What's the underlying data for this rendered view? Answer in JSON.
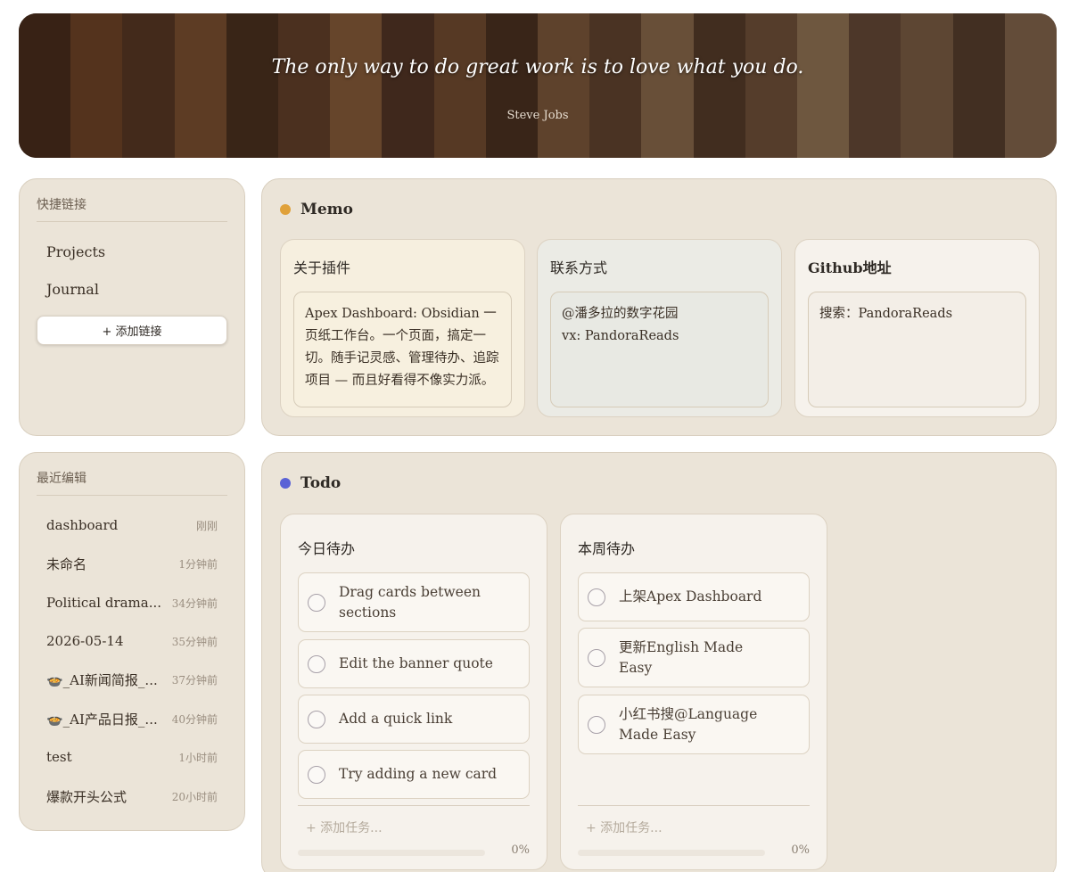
{
  "banner": {
    "quote": "The only way to do great work is to love what you do.",
    "author": "Steve Jobs"
  },
  "quick_links": {
    "title": "快捷链接",
    "items": [
      "Projects",
      "Journal"
    ],
    "add_label": "+ 添加链接"
  },
  "recent": {
    "title": "最近编辑",
    "items": [
      {
        "name": "dashboard",
        "time": "刚刚"
      },
      {
        "name": "未命名",
        "time": "1分钟前"
      },
      {
        "name": "Political drama...",
        "time": "34分钟前"
      },
      {
        "name": "2026-05-14",
        "time": "35分钟前"
      },
      {
        "name": "🍲_AI新闻简报_...",
        "time": "37分钟前"
      },
      {
        "name": "🍲_AI产品日报_...",
        "time": "40分钟前"
      },
      {
        "name": "test",
        "time": "1小时前"
      },
      {
        "name": "爆款开头公式",
        "time": "20小时前"
      }
    ]
  },
  "memo": {
    "title": "Memo",
    "accent": "#e0a13a",
    "cards": [
      {
        "title": "关于插件",
        "body": "Apex Dashboard: Obsidian 一页纸工作台。一个页面，搞定一切。随手记灵感、管理待办、追踪项目 — 而且好看得不像实力派。",
        "bg": "#f6efdf",
        "inner": "#f7f0df"
      },
      {
        "title": "联系方式",
        "body": "@潘多拉的数字花园\nvx: PandoraReads",
        "bg": "#ebebe5",
        "inner": "#e8e9e3"
      },
      {
        "title": "Github地址",
        "body": "搜索：PandoraReads",
        "bg": "#f6f2ec",
        "inner": "#f3eee7"
      }
    ]
  },
  "todo": {
    "title": "Todo",
    "accent": "#5b63d6",
    "columns": [
      {
        "title": "今日待办",
        "tasks": [
          "Drag cards between sections",
          "Edit the banner quote",
          "Add a quick link",
          "Try adding a new card"
        ],
        "add_placeholder": "+ 添加任务...",
        "progress": "0%"
      },
      {
        "title": "本周待办",
        "tasks": [
          "上架Apex Dashboard",
          "更新English Made Easy",
          "小红书搜@Language Made Easy"
        ],
        "add_placeholder": "+ 添加任务...",
        "progress": "0%"
      }
    ]
  }
}
